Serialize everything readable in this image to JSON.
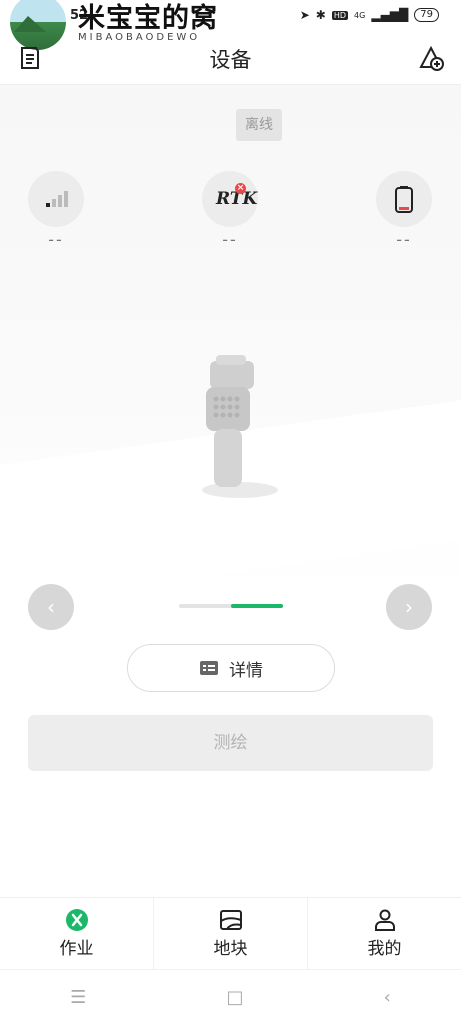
{
  "status_bar": {
    "time": "52",
    "watermark": "米宝宝的窝",
    "watermark_sub": "MIBAOBAODEWO",
    "network": "4G",
    "battery": "79"
  },
  "header": {
    "title": "设备"
  },
  "device": {
    "status": "离线",
    "signal_value": "--",
    "rtk_label": "RTK",
    "rtk_value": "--",
    "battery_value": "--"
  },
  "pager": {
    "current": 2,
    "total": 2
  },
  "actions": {
    "detail_label": "详情",
    "survey_label": "测绘"
  },
  "tabs": [
    {
      "label": "作业",
      "icon": "work-icon",
      "active": true
    },
    {
      "label": "地块",
      "icon": "map-plot-icon"
    },
    {
      "label": "我的",
      "icon": "profile-icon"
    }
  ],
  "colors": {
    "accent": "#1bb86a",
    "error": "#e84a4a"
  }
}
